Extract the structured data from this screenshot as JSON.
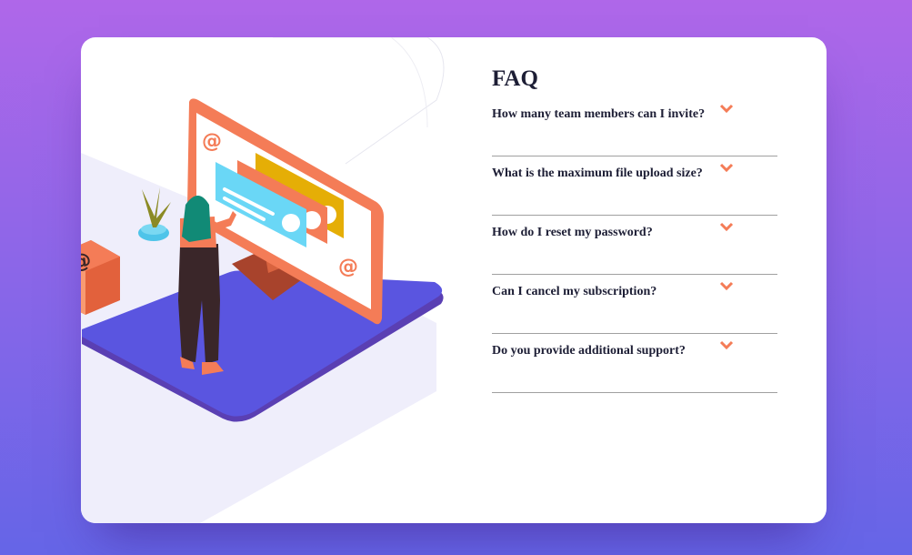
{
  "faq": {
    "title": "FAQ",
    "items": [
      {
        "question": "How many team members can I invite?",
        "icon": "chevron-down-icon"
      },
      {
        "question": "What is the maximum file upload size?",
        "icon": "chevron-down-icon"
      },
      {
        "question": "How do I reset my password?",
        "icon": "chevron-down-icon"
      },
      {
        "question": "Can I cancel my subscription?",
        "icon": "chevron-down-icon"
      },
      {
        "question": "Do you provide additional support?",
        "icon": "chevron-down-icon"
      }
    ]
  },
  "colors": {
    "background_top": "#af67e9",
    "background_bottom": "#6565e7",
    "card": "#ffffff",
    "heading_text": "#1d1e35",
    "chevron": "#f47c57",
    "divider": "#a0a0a0",
    "platform": "#5a55e0",
    "monitor": "#f47c57"
  }
}
